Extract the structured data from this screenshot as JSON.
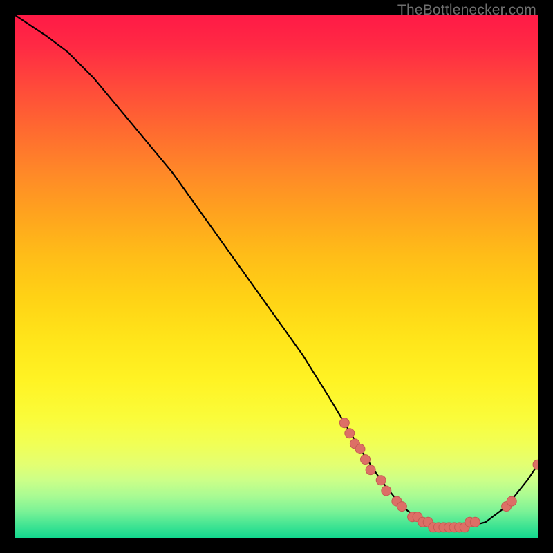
{
  "watermark": {
    "text": "TheBottlenecker.com"
  },
  "colors": {
    "curve": "#000000",
    "marker_fill": "#dd6f66",
    "marker_stroke": "#c45a52"
  },
  "chart_data": {
    "type": "line",
    "title": "",
    "xlabel": "",
    "ylabel": "",
    "xlim": [
      0,
      100
    ],
    "ylim": [
      0,
      100
    ],
    "background": "rainbow-vertical-gradient (red→orange→yellow→green bottom)",
    "series": [
      {
        "name": "bottleneck-curve",
        "x": [
          0,
          6,
          10,
          15,
          20,
          25,
          30,
          35,
          40,
          45,
          50,
          55,
          60,
          63,
          66,
          70,
          74,
          78,
          82,
          86,
          90,
          94,
          98,
          100
        ],
        "y": [
          100,
          96,
          93,
          88,
          82,
          76,
          70,
          63,
          56,
          49,
          42,
          35,
          27,
          22,
          17,
          11,
          6,
          3,
          2,
          2,
          3,
          6,
          11,
          14
        ]
      }
    ],
    "markers": {
      "name": "highlighted-points",
      "points": [
        {
          "x": 63,
          "y": 22
        },
        {
          "x": 64,
          "y": 20
        },
        {
          "x": 65,
          "y": 18
        },
        {
          "x": 66,
          "y": 17
        },
        {
          "x": 67,
          "y": 15
        },
        {
          "x": 68,
          "y": 13
        },
        {
          "x": 70,
          "y": 11
        },
        {
          "x": 71,
          "y": 9
        },
        {
          "x": 73,
          "y": 7
        },
        {
          "x": 74,
          "y": 6
        },
        {
          "x": 76,
          "y": 4
        },
        {
          "x": 77,
          "y": 4
        },
        {
          "x": 78,
          "y": 3
        },
        {
          "x": 79,
          "y": 3
        },
        {
          "x": 80,
          "y": 2
        },
        {
          "x": 81,
          "y": 2
        },
        {
          "x": 82,
          "y": 2
        },
        {
          "x": 83,
          "y": 2
        },
        {
          "x": 84,
          "y": 2
        },
        {
          "x": 85,
          "y": 2
        },
        {
          "x": 86,
          "y": 2
        },
        {
          "x": 87,
          "y": 3
        },
        {
          "x": 88,
          "y": 3
        },
        {
          "x": 94,
          "y": 6
        },
        {
          "x": 95,
          "y": 7
        },
        {
          "x": 100,
          "y": 14
        }
      ]
    }
  }
}
